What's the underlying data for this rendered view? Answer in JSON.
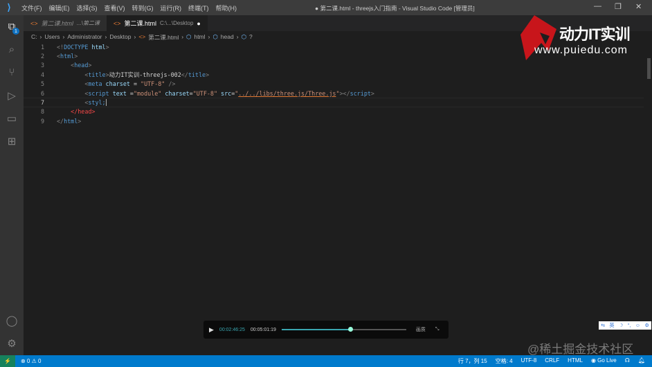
{
  "menu": [
    "文件(F)",
    "编辑(E)",
    "选择(S)",
    "查看(V)",
    "转到(G)",
    "运行(R)",
    "终端(T)",
    "帮助(H)"
  ],
  "window_title": "● 第二课.html - threejs入门指南 - Visual Studio Code [管理员]",
  "activity_badge": "1",
  "tabs": [
    {
      "label": "第二课.html",
      "desc": "...\\第二课"
    },
    {
      "label": "第二课.html",
      "desc": "C:\\...\\Desktop",
      "dirty": "●"
    }
  ],
  "breadcrumb": [
    "C:",
    "Users",
    "Administrator",
    "Desktop",
    "第二课.html",
    "html",
    "head",
    "?"
  ],
  "code_lines": [
    "1",
    "2",
    "3",
    "4",
    "5",
    "6",
    "7",
    "8",
    "9"
  ],
  "code": {
    "l1a": "<!",
    "l1b": "DOCTYPE",
    "l1c": " html",
    "title_text": "动力IT实训-threejs-002",
    "meta_val": "\"UTF-8\"",
    "script_text": "\"module\"",
    "script_charset": "\"UTF-8\"",
    "script_src": "../../libs/three.js/Three.js",
    "styl": "styl;"
  },
  "watermark": {
    "brand": "动力IT实训",
    "url": "www.puiedu.com"
  },
  "player": {
    "current": "00:02:46:25",
    "total": "00:05:01:19",
    "progress": 0.55,
    "quality": "画质"
  },
  "ime": [
    "⇆",
    "英",
    "☽",
    "°,",
    "☺",
    "⚙"
  ],
  "juejin": "@稀土掘金技术社区",
  "status": {
    "problems": "⊗ 0 ⚠ 0",
    "position": "行 7，列 15",
    "spaces": "空格: 4",
    "encoding": "UTF-8",
    "eol": "CRLF",
    "language": "HTML",
    "golive": "Go Live"
  }
}
